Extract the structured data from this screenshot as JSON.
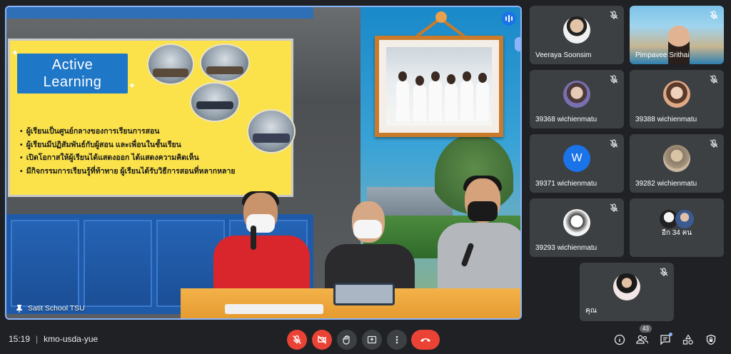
{
  "stage": {
    "presenter_name": "Satit School TSU",
    "slide": {
      "title_line1": "Active",
      "title_line2": "Learning",
      "bullets": [
        "ผู้เรียนเป็นศูนย์กลางของการเรียนการสอน",
        "ผู้เรียนมีปฏิสัมพันธ์กับผู้สอน และเพื่อนในชั้นเรียน",
        "เปิดโอกาสให้ผู้เรียนได้แสดงออก ได้แสดงความคิดเห็น",
        "มีกิจกรรมการเรียนรู้ที่ท้าทาย ผู้เรียนได้รับวิธีการสอนที่หลากหลาย"
      ]
    }
  },
  "participants": [
    {
      "name": "Veeraya Soonsim",
      "avatar_icon": "user-photo-icon",
      "muted": true
    },
    {
      "name": "Pimpavee Srithai",
      "avatar_icon": "camera-video",
      "muted": true
    },
    {
      "name": "39368 wichienmatu",
      "avatar_icon": "user-photo-icon",
      "muted": true
    },
    {
      "name": "39388 wichienmatu",
      "avatar_icon": "user-photo-icon",
      "muted": true
    },
    {
      "name": "39371 wichienmatu",
      "avatar_letter": "W",
      "muted": true
    },
    {
      "name": "39282 wichienmatu",
      "avatar_icon": "user-photo-icon",
      "muted": true
    },
    {
      "name": "39293 wichienmatu",
      "avatar_icon": "user-photo-icon",
      "muted": true
    },
    {
      "name": "อีก 34 คน",
      "avatar_icon": "group-avatars",
      "muted": false
    },
    {
      "name": "คุณ",
      "avatar_icon": "user-photo-icon",
      "muted": true
    }
  ],
  "bottombar": {
    "time": "15:19",
    "separator": "|",
    "meeting_code": "kmo-usda-yue",
    "people_count": "43"
  },
  "colors": {
    "accent": "#8ab4f8",
    "danger": "#ea4335",
    "tile_bg": "#3c4043",
    "page_bg": "#202124"
  }
}
